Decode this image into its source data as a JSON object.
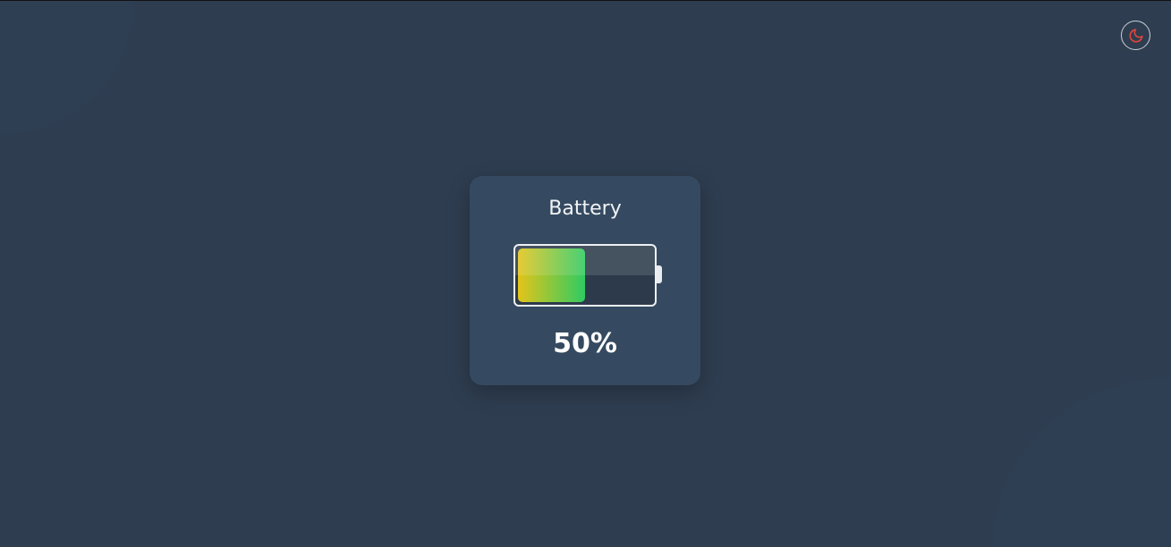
{
  "card": {
    "title": "Battery",
    "percent_label": "50%",
    "level_percent": 50
  },
  "theme_toggle": {
    "icon": "moon-icon",
    "color": "#e0443a"
  }
}
